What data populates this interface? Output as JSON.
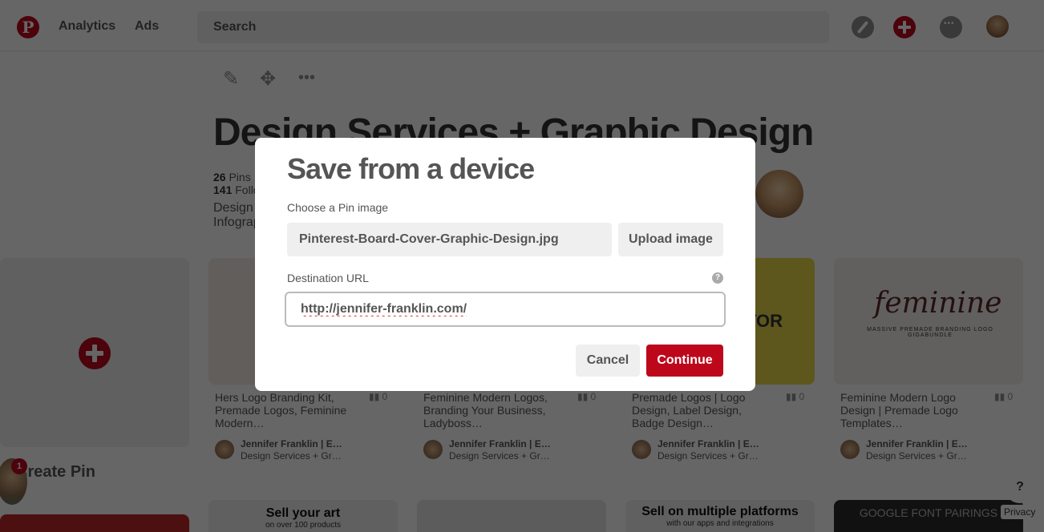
{
  "header": {
    "logo": "P",
    "nav": [
      "Analytics",
      "Ads"
    ],
    "search_placeholder": "Search",
    "icons": [
      "compass-icon",
      "add-icon",
      "messages-icon",
      "profile-avatar"
    ]
  },
  "board": {
    "tools": [
      "pencil-icon",
      "move-icon",
      "more-icon"
    ],
    "title": "Design Services + Graphic Design",
    "pins_count": "26",
    "pins_label": " Pins",
    "followers_count": "141",
    "followers_label": " Followers",
    "description_line1": "Design",
    "description_line2": "Infographics"
  },
  "create_pin_label": "Create Pin",
  "notification_count": "1",
  "pins": [
    {
      "title": "Hers Logo Branding Kit, Premade Logos, Feminine Modern…",
      "stat": "0",
      "author": "Jennifer Franklin | E…",
      "board": "Design Services + Gr…"
    },
    {
      "title": "Feminine Modern Logos, Branding Your Business, Ladyboss…",
      "stat": "0",
      "author": "Jennifer Franklin | E…",
      "board": "Design Services + Gr…"
    },
    {
      "title": "Premade Logos | Logo Design, Label Design, Badge Design…",
      "stat": "0",
      "author": "Jennifer Franklin | E…",
      "board": "Design Services + Gr…"
    },
    {
      "title": "Feminine Modern Logo Design | Premade Logo Templates…",
      "stat": "0",
      "author": "Jennifer Franklin | E…",
      "board": "Design Services + Gr…"
    }
  ],
  "pin_image_texts": {
    "pin3": "TOR",
    "pin4_script": "feminine",
    "pin4_sub": "MASSIVE PREMADE BRANDING LOGO GIGABUNDLE"
  },
  "promos": [
    {
      "title": "Sell your art",
      "subtitle": "on over 100 products"
    },
    {
      "title": "",
      "subtitle": ""
    },
    {
      "title": "Sell on multiple platforms",
      "subtitle": "with our apps and integrations"
    },
    {
      "title": "GOOGLE FONT PAIRINGS",
      "subtitle": ""
    }
  ],
  "help_fab": "?",
  "privacy": "Privacy",
  "modal": {
    "title": "Save from a device",
    "image_label": "Choose a Pin image",
    "file_name": "Pinterest-Board-Cover-Graphic-Design.jpg",
    "upload_button": "Upload image",
    "url_label": "Destination URL",
    "url_help": "?",
    "url_value": "http://jennifer-franklin.com/",
    "cancel": "Cancel",
    "continue": "Continue"
  },
  "colors": {
    "brand_red": "#bd081c",
    "overlay": "rgba(0,0,0,0.6)"
  }
}
